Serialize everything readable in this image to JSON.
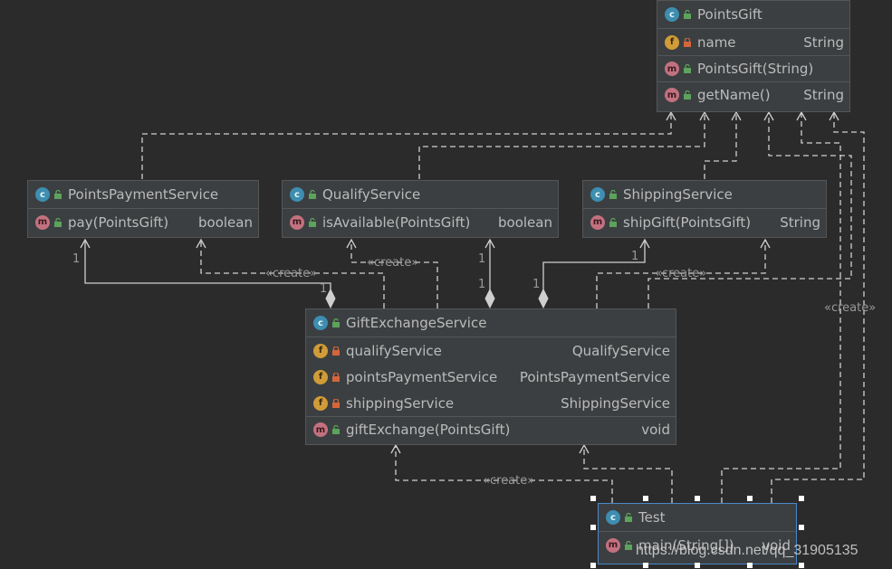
{
  "classes": {
    "points_gift": {
      "name": "PointsGift",
      "fields": [
        {
          "name": "name",
          "type": "String"
        }
      ],
      "constructors": [
        {
          "name": "PointsGift(String)",
          "type": ""
        }
      ],
      "methods": [
        {
          "name": "getName()",
          "type": "String"
        }
      ]
    },
    "points_payment_service": {
      "name": "PointsPaymentService",
      "methods": [
        {
          "name": "pay(PointsGift)",
          "type": "boolean"
        }
      ]
    },
    "qualify_service": {
      "name": "QualifyService",
      "methods": [
        {
          "name": "isAvailable(PointsGift)",
          "type": "boolean"
        }
      ]
    },
    "shipping_service": {
      "name": "ShippingService",
      "methods": [
        {
          "name": "shipGift(PointsGift)",
          "type": "String"
        }
      ]
    },
    "gift_exchange_service": {
      "name": "GiftExchangeService",
      "fields": [
        {
          "name": "qualifyService",
          "type": "QualifyService"
        },
        {
          "name": "pointsPaymentService",
          "type": "PointsPaymentService"
        },
        {
          "name": "shippingService",
          "type": "ShippingService"
        }
      ],
      "methods": [
        {
          "name": "giftExchange(PointsGift)",
          "type": "void"
        }
      ]
    },
    "test": {
      "name": "Test",
      "methods": [
        {
          "name": "main(String[])",
          "type": "void"
        }
      ]
    }
  },
  "relations": {
    "create_label": "«create»",
    "multiplicity": "1"
  },
  "badges": {
    "class": "c",
    "field": "f",
    "method": "m"
  },
  "watermark": "https://blog.csdn.net/qq_31905135",
  "colors": {
    "background": "#2b2b2b",
    "class_fill": "#3c3f41",
    "border": "#555555",
    "line": "#cfcfcf",
    "class_badge": "#3d8eb0",
    "field_badge": "#d09c38",
    "method_badge": "#c3717f",
    "selection": "#4a88c7"
  }
}
